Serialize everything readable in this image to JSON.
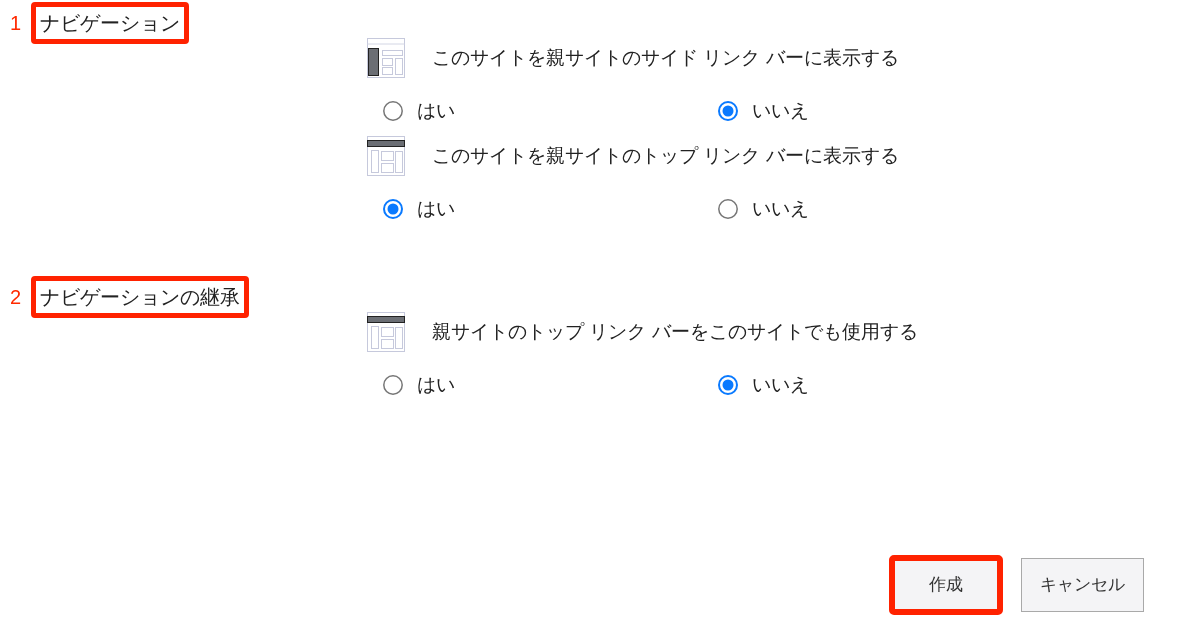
{
  "sections": [
    {
      "number": "1",
      "title": "ナビゲーション",
      "highlighted": true,
      "settings": [
        {
          "kind": "side",
          "label": "このサイトを親サイトのサイド リンク バーに表示する",
          "options": [
            {
              "label": "はい",
              "selected": false
            },
            {
              "label": "いいえ",
              "selected": true
            }
          ]
        },
        {
          "kind": "top",
          "label": "このサイトを親サイトのトップ リンク バーに表示する",
          "options": [
            {
              "label": "はい",
              "selected": true
            },
            {
              "label": "いいえ",
              "selected": false
            }
          ]
        }
      ]
    },
    {
      "number": "2",
      "title": "ナビゲーションの継承",
      "highlighted": true,
      "settings": [
        {
          "kind": "top",
          "label": "親サイトのトップ リンク バーをこのサイトでも使用する",
          "options": [
            {
              "label": "はい",
              "selected": false
            },
            {
              "label": "いいえ",
              "selected": true
            }
          ]
        }
      ]
    }
  ],
  "buttons": [
    {
      "label": "作成",
      "highlighted": true
    },
    {
      "label": "キャンセル",
      "highlighted": false
    }
  ]
}
